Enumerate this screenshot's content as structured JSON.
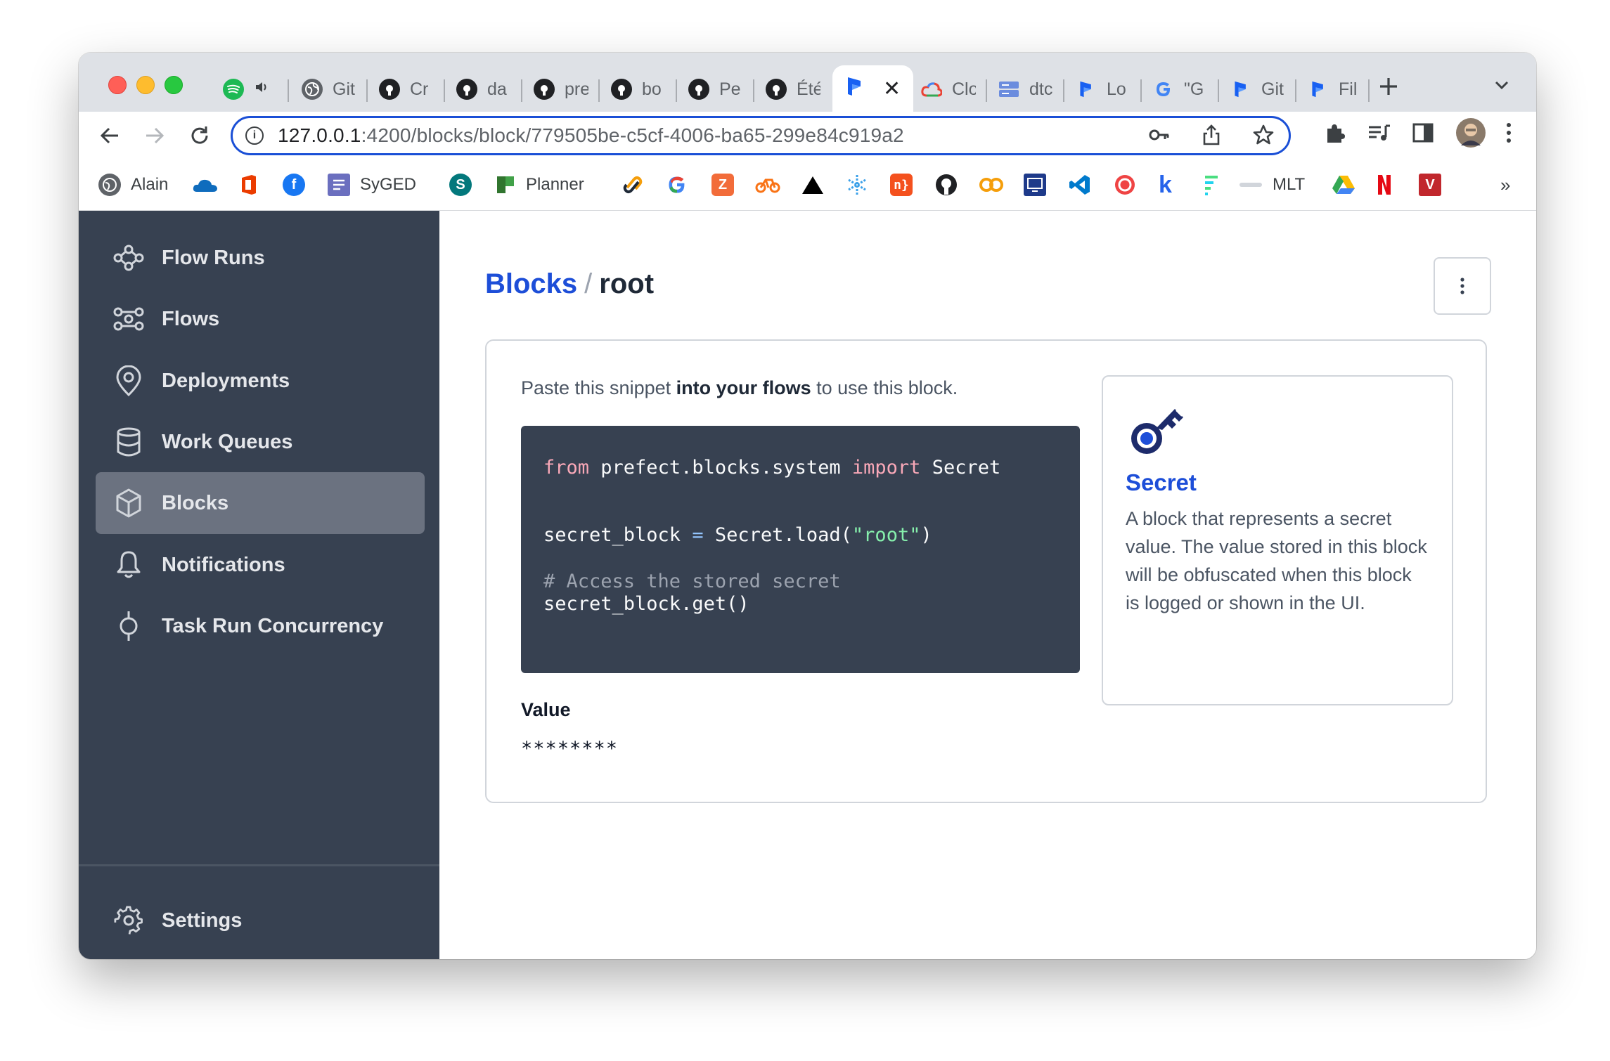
{
  "browser": {
    "tabs": [
      {
        "label": "",
        "icon": "spotify-icon",
        "color": "#1db954",
        "audio": "speaker-icon"
      },
      {
        "label": "Git",
        "icon": "globe-icon",
        "color": "#5f6368"
      },
      {
        "label": "Cr",
        "icon": "github-icon",
        "color": "#202124"
      },
      {
        "label": "da",
        "icon": "github-icon",
        "color": "#202124"
      },
      {
        "label": "pre",
        "icon": "github-icon",
        "color": "#202124"
      },
      {
        "label": "bo",
        "icon": "github-icon",
        "color": "#202124"
      },
      {
        "label": "Pe",
        "icon": "github-icon",
        "color": "#202124"
      },
      {
        "label": "Été",
        "icon": "github-icon",
        "color": "#202124"
      },
      {
        "label": "",
        "icon": "prefect-icon",
        "color": "#1860f2",
        "active": true
      },
      {
        "label": "Clo",
        "icon": "cloud-icon",
        "color": "#fbbc04"
      },
      {
        "label": "dtc",
        "icon": "server-icon",
        "color": "#6b8cde"
      },
      {
        "label": "Lo",
        "icon": "prefect-icon",
        "color": "#1860f2"
      },
      {
        "label": "\"G",
        "icon": "google-icon",
        "color": "#4285f4"
      },
      {
        "label": "Git",
        "icon": "prefect-icon",
        "color": "#1860f2"
      },
      {
        "label": "Fil",
        "icon": "prefect-icon",
        "color": "#1860f2"
      }
    ],
    "url_host": "127.0.0.1",
    "url_path": ":4200/blocks/block/779505be-c5cf-4006-ba65-299e84c919a2",
    "bookmarks": [
      {
        "label": "Alain",
        "icon": "globe-icon",
        "color": "#5f6368"
      },
      {
        "label": "",
        "icon": "onedrive-icon",
        "color": "#0f6cbd"
      },
      {
        "label": "",
        "icon": "office-icon",
        "color": "#eb3c00"
      },
      {
        "label": "",
        "icon": "facebook-icon",
        "color": "#1877f2"
      },
      {
        "label": "SyGED",
        "icon": "syged-icon",
        "color": "#6b6fbf"
      },
      {
        "label": "",
        "icon": "sharepoint-icon",
        "color": "#03787c"
      },
      {
        "label": "Planner",
        "icon": "planner-icon",
        "color": "#31752f"
      },
      {
        "label": "",
        "icon": "link-icon",
        "color": "#f59e0b"
      },
      {
        "label": "",
        "icon": "google-icon",
        "color": "#4285f4"
      },
      {
        "label": "",
        "icon": "z-icon",
        "color": "#f26c3a"
      },
      {
        "label": "",
        "icon": "bike-icon",
        "color": "#f97316"
      },
      {
        "label": "",
        "icon": "triangle-icon",
        "color": "#000000"
      },
      {
        "label": "",
        "icon": "snowflake-icon",
        "color": "#3aa0e9"
      },
      {
        "label": "",
        "icon": "n-icon",
        "color": "#f4511e"
      },
      {
        "label": "",
        "icon": "github-icon",
        "color": "#202124"
      },
      {
        "label": "",
        "icon": "co-icon",
        "color": "#f59e0b"
      },
      {
        "label": "",
        "icon": "monitor-icon",
        "color": "#1e3a8a"
      },
      {
        "label": "",
        "icon": "vscode-icon",
        "color": "#007acc"
      },
      {
        "label": "",
        "icon": "target-icon",
        "color": "#ef4444"
      },
      {
        "label": "",
        "icon": "k-icon",
        "color": "#2563eb"
      },
      {
        "label": "",
        "icon": "bars-icon",
        "color": "#4ade80"
      },
      {
        "label": "MLT",
        "icon": "mlt-icon",
        "color": "#9ca3af"
      },
      {
        "label": "",
        "icon": "drive-icon",
        "color": "#34a853"
      },
      {
        "label": "",
        "icon": "netflix-icon",
        "color": "#e50914"
      },
      {
        "label": "",
        "icon": "v-icon",
        "color": "#c1272d"
      }
    ],
    "more_bookmarks": "»"
  },
  "sidebar": {
    "items": [
      {
        "label": "Flow Runs",
        "icon": "flow-runs-icon"
      },
      {
        "label": "Flows",
        "icon": "flows-icon"
      },
      {
        "label": "Deployments",
        "icon": "location-pin-icon"
      },
      {
        "label": "Work Queues",
        "icon": "database-icon"
      },
      {
        "label": "Blocks",
        "icon": "cube-icon",
        "active": true
      },
      {
        "label": "Notifications",
        "icon": "bell-icon"
      },
      {
        "label": "Task Run Concurrency",
        "icon": "concurrency-icon"
      }
    ],
    "settings_label": "Settings"
  },
  "page": {
    "breadcrumb_link": "Blocks",
    "breadcrumb_sep": "/",
    "breadcrumb_current": "root",
    "snippet_pre": "Paste this snippet ",
    "snippet_bold": "into your flows",
    "snippet_post": " to use this block.",
    "code": {
      "l1_kw1": "from",
      "l1_mod": " prefect.blocks.system ",
      "l1_kw2": "import",
      "l1_name": " Secret",
      "l2_var": "secret_block ",
      "l2_op": "=",
      "l2_call": " Secret.load(",
      "l2_str": "\"root\"",
      "l2_close": ")",
      "l3_comment": "# Access the stored secret",
      "l4": "secret_block.get()"
    },
    "value_label": "Value",
    "value": "********",
    "block_type": {
      "name": "Secret",
      "icon": "key-icon",
      "description": "A block that represents a secret value. The value stored in this block will be obfuscated when this block is logged or shown in the UI."
    }
  },
  "colors": {
    "sidebar_bg": "#374151",
    "accent": "#1d4ed8",
    "code_bg": "#374151"
  }
}
